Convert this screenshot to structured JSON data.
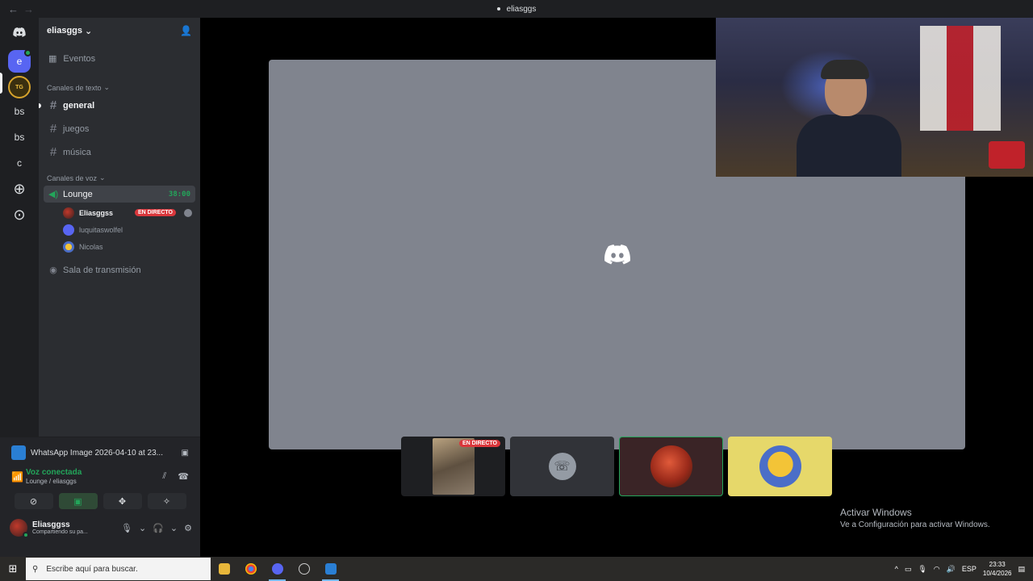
{
  "window": {
    "title": "eliasggs"
  },
  "server": {
    "name": "eliasggs",
    "events_label": "Eventos",
    "text_category": "Canales de texto",
    "text_channels": [
      "general",
      "juegos",
      "música"
    ],
    "voice_category": "Canales de voz",
    "voice_channel": {
      "name": "Lounge",
      "timer": "38:00"
    },
    "voice_users": [
      {
        "name": "Eliasggss",
        "badge": "EN DIRECTO"
      },
      {
        "name": "luquitaswolfel"
      },
      {
        "name": "Nicolas"
      }
    ],
    "stage_channel": "Sala de transmisión"
  },
  "rail": {
    "items": [
      "e",
      "TG",
      "bs",
      "bs",
      "c"
    ]
  },
  "panel": {
    "stream_title": "WhatsApp Image 2026-04-10 at 23...",
    "voice_status": "Voz conectada",
    "voice_location": "Lounge / eliasggs",
    "user_name": "Eliasggss",
    "user_status": "Compartiendo su pa..."
  },
  "stage": {
    "thumb_live_badge": "EN DIRECTO"
  },
  "watermark": {
    "line1": "Activar Windows",
    "line2": "Ve a Configuración para activar Windows."
  },
  "taskbar": {
    "search_placeholder": "Escribe aquí para buscar.",
    "lang": "ESP",
    "time": "23:33",
    "date": "10/4/2026"
  },
  "colors": {
    "accent": "#5865f2",
    "online": "#23a55a",
    "live": "#da373c"
  }
}
